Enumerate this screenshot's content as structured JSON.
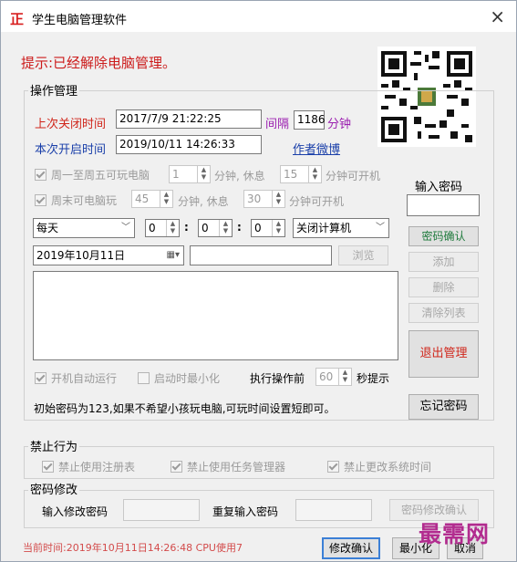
{
  "window": {
    "title": "学生电脑管理软件",
    "close_glyph": "×",
    "app_icon_glyph": "正"
  },
  "notice": "提示:已经解除电脑管理。",
  "ops": {
    "group_label": "操作管理",
    "last_shutdown_label": "上次关闭时间",
    "last_shutdown_value": "2017/7/9 21:22:25",
    "interval_label": "间隔",
    "interval_value": "1186",
    "minutes_unit": "分钟",
    "current_start_label": "本次开启时间",
    "current_start_value": "2019/10/11 14:26:33",
    "author_weibo_link": "作者微博",
    "weekday_label": "周一至周五可玩电脑",
    "weekday_play_value": "1",
    "weekday_mid1": "分钟, 休息",
    "weekday_rest_value": "15",
    "weekday_tail": "分钟可开机",
    "weekend_label": "周末可电脑玩",
    "weekend_play_value": "45",
    "weekend_mid1": "分钟, 休息",
    "weekend_rest_value": "30",
    "weekend_tail": "分钟可开机",
    "repeat_select": "每天",
    "hour_value": "0",
    "min_value": "0",
    "sec_value": "0",
    "colon": ":",
    "action_select": "关闭计算机",
    "date_value": "2019年10月11日",
    "browse_button": "浏览",
    "autorun_label": "开机自动运行",
    "minimize_label": "启动时最小化",
    "before_exec_label": "执行操作前",
    "before_exec_value": "60",
    "seconds_prompt": "秒提示",
    "hint_text": "初始密码为123,如果不希望小孩玩电脑,可玩时间设置短即可。"
  },
  "right_panel": {
    "password_label": "输入密码",
    "confirm_password_button": "密码确认",
    "add_button": "添加",
    "delete_button": "删除",
    "clear_list_button": "清除列表",
    "exit_management_button": "退出管理",
    "forgot_password_button": "忘记密码"
  },
  "forbid": {
    "group_label": "禁止行为",
    "registry_label": "禁止使用注册表",
    "taskmgr_label": "禁止使用任务管理器",
    "systime_label": "禁止更改系统时间"
  },
  "pwdchange": {
    "group_label": "密码修改",
    "new_label": "输入修改密码",
    "repeat_label": "重复输入密码",
    "confirm_button": "密码修改确认"
  },
  "footer": {
    "status_text": "当前时间:2019年10月11日14:26:48 CPU使用7",
    "modify_confirm_button": "修改确认",
    "minimize_button": "最小化",
    "cancel_button": "取消"
  },
  "watermark": "最需网",
  "colors": {
    "notice": "#cc1b1b",
    "label_red": "#d0261b",
    "label_blue": "#1a3fa9",
    "purple": "#9b20b0",
    "watermark": "#b22c8f"
  }
}
